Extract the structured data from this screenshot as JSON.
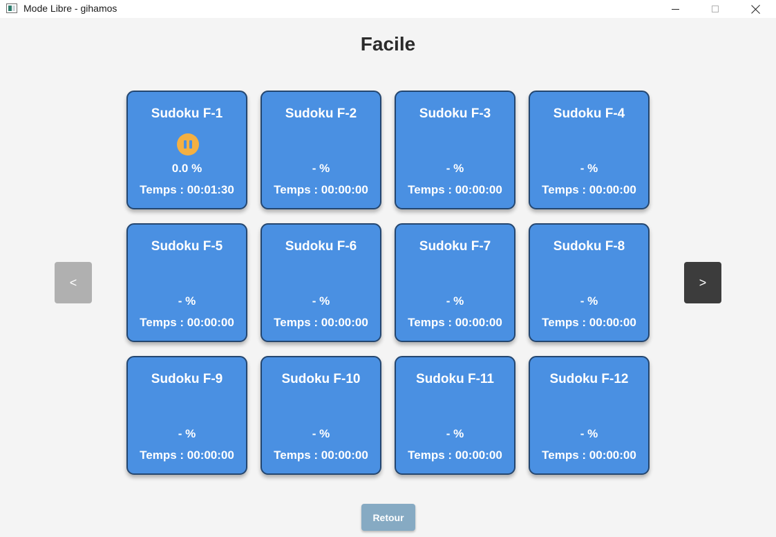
{
  "window": {
    "title": "Mode Libre - gihamos",
    "controls": [
      "minimize-icon",
      "maximize-icon",
      "close-icon"
    ]
  },
  "page": {
    "title": "Facile"
  },
  "navigation": {
    "prev_label": "<",
    "next_label": ">"
  },
  "cards": [
    {
      "title": "Sudoku F-1",
      "percent": "0.0 %",
      "time": "Temps : 00:01:30",
      "status_icon": "pause-icon"
    },
    {
      "title": "Sudoku F-2",
      "percent": "- %",
      "time": "Temps : 00:00:00"
    },
    {
      "title": "Sudoku F-3",
      "percent": "- %",
      "time": "Temps : 00:00:00"
    },
    {
      "title": "Sudoku F-4",
      "percent": "- %",
      "time": "Temps : 00:00:00"
    },
    {
      "title": "Sudoku F-5",
      "percent": "- %",
      "time": "Temps : 00:00:00"
    },
    {
      "title": "Sudoku F-6",
      "percent": "- %",
      "time": "Temps : 00:00:00"
    },
    {
      "title": "Sudoku F-7",
      "percent": "- %",
      "time": "Temps : 00:00:00"
    },
    {
      "title": "Sudoku F-8",
      "percent": "- %",
      "time": "Temps : 00:00:00"
    },
    {
      "title": "Sudoku F-9",
      "percent": "- %",
      "time": "Temps : 00:00:00"
    },
    {
      "title": "Sudoku F-10",
      "percent": "- %",
      "time": "Temps : 00:00:00"
    },
    {
      "title": "Sudoku F-11",
      "percent": "- %",
      "time": "Temps : 00:00:00"
    },
    {
      "title": "Sudoku F-12",
      "percent": "- %",
      "time": "Temps : 00:00:00"
    }
  ],
  "footer": {
    "back_label": "Retour"
  },
  "colors": {
    "card_bg": "#4a90e2",
    "card_border": "#24466f",
    "badge": "#f4b042",
    "nav_prev": "#b0b0b0",
    "nav_next": "#3c3c3c",
    "back_button": "#86aac3"
  }
}
